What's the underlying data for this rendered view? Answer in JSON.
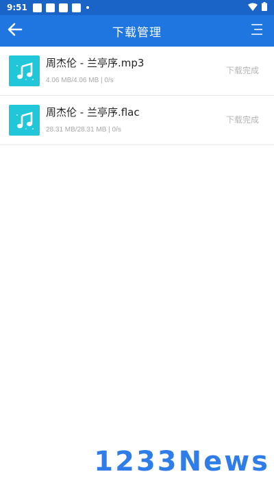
{
  "status_bar": {
    "time": "9:51",
    "icons": [
      "notification-icon",
      "notification-icon",
      "notification-icon",
      "notification-icon",
      "more-notifications-dot",
      "wifi-icon",
      "battery-icon"
    ]
  },
  "app_bar": {
    "title": "下载管理",
    "back_icon": "arrow-left-icon",
    "menu_icon": "menu-icon",
    "background": "#1f76e0"
  },
  "downloads": [
    {
      "icon": "music-note-icon",
      "title": "周杰伦 - 兰亭序.mp3",
      "meta": "4.06 MB/4.06 MB | 0/s",
      "status": "下载完成"
    },
    {
      "icon": "music-note-icon",
      "title": "周杰伦 - 兰亭序.flac",
      "meta": "28.31 MB/28.31 MB | 0/s",
      "status": "下载完成"
    }
  ],
  "watermark": "1233News",
  "colors": {
    "accent": "#1f76e0",
    "file_icon_bg": "#22c6d9",
    "status_text": "#b5b5b5"
  }
}
